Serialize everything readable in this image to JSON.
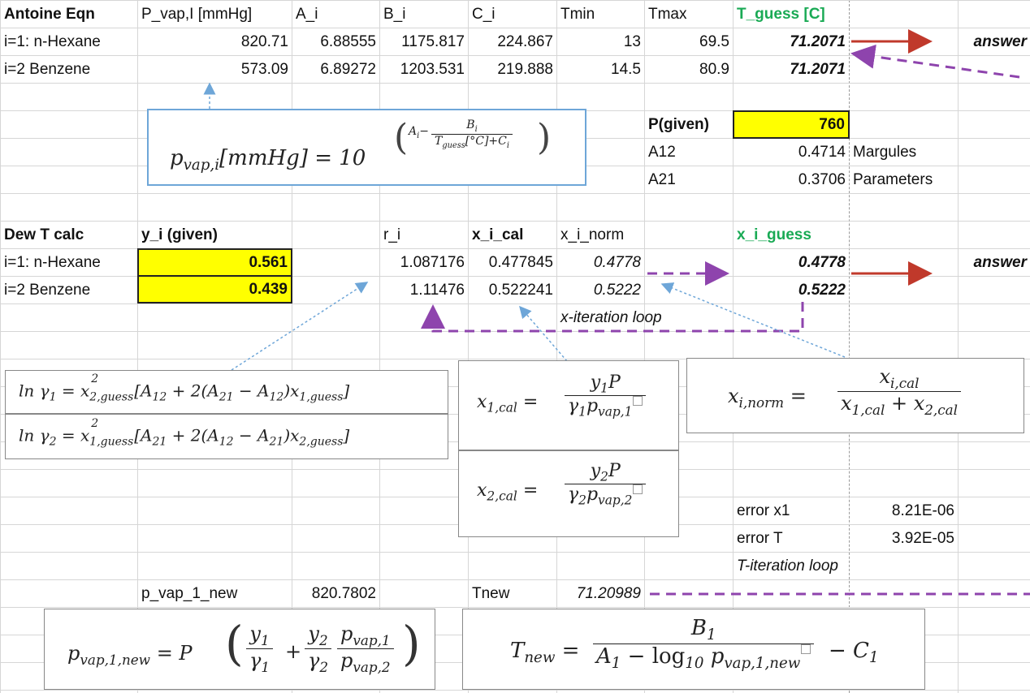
{
  "header": {
    "antoine": "Antoine Eqn",
    "pvap": "P_vap,I [mmHg]",
    "a": "A_i",
    "b": "B_i",
    "c": "C_i",
    "tmin": "Tmin",
    "tmax": "Tmax",
    "tguess": "T_guess [C]"
  },
  "antoine_rows": [
    {
      "name": "i=1: n-Hexane",
      "pvap": "820.71",
      "a": "6.88555",
      "b": "1175.817",
      "c": "224.867",
      "tmin": "13",
      "tmax": "69.5",
      "tguess": "71.2071"
    },
    {
      "name": "i=2 Benzene",
      "pvap": "573.09",
      "a": "6.89272",
      "b": "1203.531",
      "c": "219.888",
      "tmin": "14.5",
      "tmax": "80.9",
      "tguess": "71.2071"
    }
  ],
  "answer_label": "answer",
  "params": {
    "p_label": "P(given)",
    "p_value": "760",
    "a12_label": "A12",
    "a12_value": "0.4714",
    "a12_note": "Margules",
    "a21_label": "A21",
    "a21_value": "0.3706",
    "a21_note": "Parameters"
  },
  "dew_header": {
    "title": "Dew T calc",
    "y": "y_i (given)",
    "r": "r_i",
    "xcal": "x_i_cal",
    "xnorm": "x_i_norm",
    "xguess": "x_i_guess"
  },
  "dew_rows": [
    {
      "name": "i=1: n-Hexane",
      "y": "0.561",
      "r": "1.087176",
      "xcal": "0.477845",
      "xnorm": "0.4778",
      "xguess": "0.4778"
    },
    {
      "name": "i=2 Benzene",
      "y": "0.439",
      "r": "1.11476",
      "xcal": "0.522241",
      "xnorm": "0.5222",
      "xguess": "0.5222"
    }
  ],
  "x_loop_label": "x-iteration loop",
  "errors": {
    "x1_label": "error x1",
    "x1_value": "8.21E-06",
    "t_label": "error T",
    "t_value": "3.92E-05",
    "t_loop_label": "T-iteration loop"
  },
  "bottom": {
    "pvap_new_label": "p_vap_1_new",
    "pvap_new_value": "820.7802",
    "tnew_label": "Tnew",
    "tnew_value": "71.20989"
  },
  "colors": {
    "highlight": "#ffff00",
    "arrow_red": "#c0392b",
    "arrow_purple": "#8e44ad",
    "pointer_blue": "#6ea6d8",
    "header_green": "#1aaa55"
  }
}
